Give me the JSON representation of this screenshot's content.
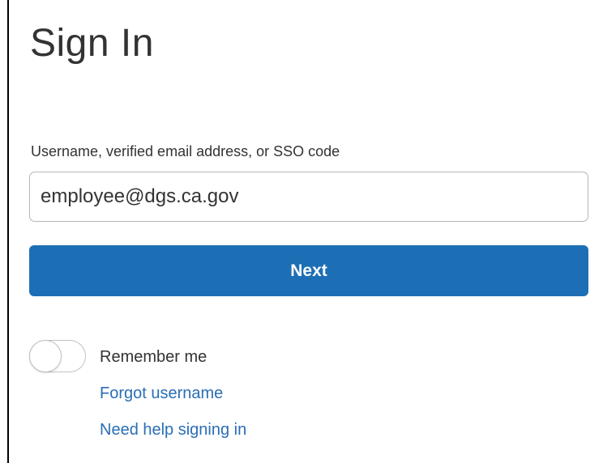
{
  "page": {
    "title": "Sign In"
  },
  "login_form": {
    "username_label": "Username, verified email address, or SSO code",
    "username_value": "employee@dgs.ca.gov",
    "next_label": "Next",
    "remember_me_label": "Remember me",
    "remember_me_on": false,
    "forgot_username_label": "Forgot username",
    "help_label": "Need help signing in"
  },
  "colors": {
    "primary_button": "#1d6fb5",
    "link": "#2a6eb5",
    "text": "#333333"
  }
}
